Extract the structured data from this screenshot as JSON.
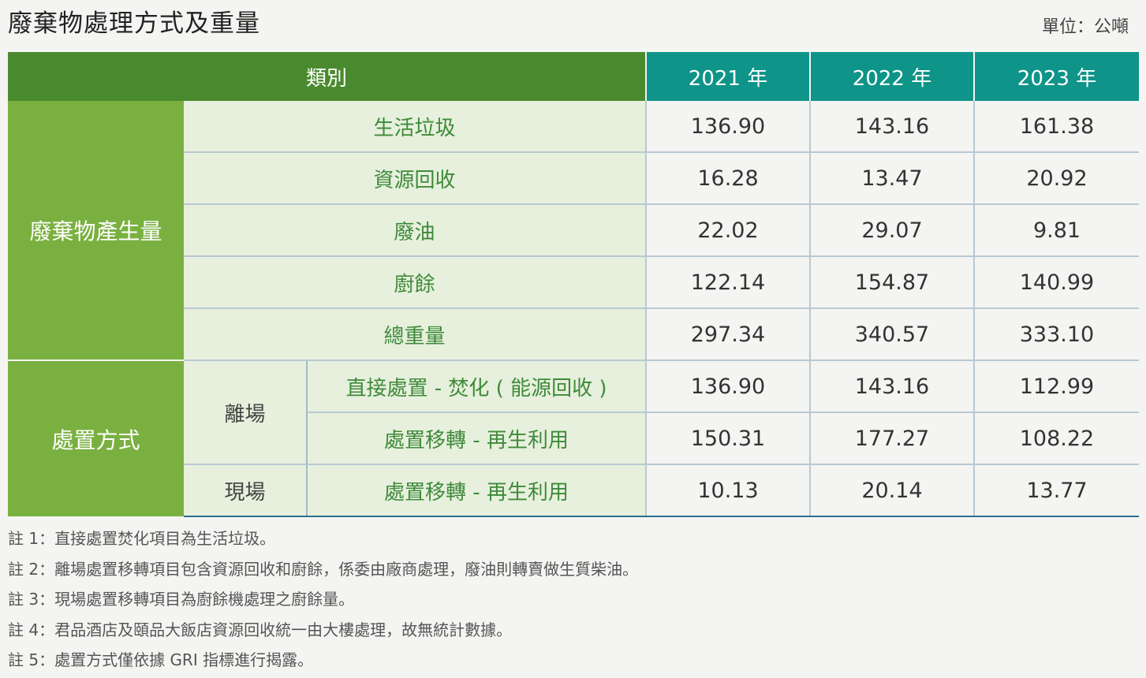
{
  "title": "廢棄物處理方式及重量",
  "unit": "單位：公噸",
  "header": {
    "category": "類別",
    "years": [
      "2021 年",
      "2022 年",
      "2023 年"
    ]
  },
  "groups": {
    "generation": "廢棄物產生量",
    "disposal": "處置方式",
    "offsite": "離場",
    "onsite": "現場"
  },
  "rows": [
    {
      "label": "生活垃圾",
      "values": [
        "136.90",
        "143.16",
        "161.38"
      ]
    },
    {
      "label": "資源回收",
      "values": [
        "16.28",
        "13.47",
        "20.92"
      ]
    },
    {
      "label": "廢油",
      "values": [
        "22.02",
        "29.07",
        "9.81"
      ]
    },
    {
      "label": "廚餘",
      "values": [
        "122.14",
        "154.87",
        "140.99"
      ]
    },
    {
      "label": "總重量",
      "values": [
        "297.34",
        "340.57",
        "333.10"
      ]
    },
    {
      "label": "直接處置 - 焚化 ( 能源回收 )",
      "values": [
        "136.90",
        "143.16",
        "112.99"
      ]
    },
    {
      "label": "處置移轉 - 再生利用",
      "values": [
        "150.31",
        "177.27",
        "108.22"
      ]
    },
    {
      "label": "處置移轉 - 再生利用",
      "values": [
        "10.13",
        "20.14",
        "13.77"
      ]
    }
  ],
  "notes": [
    "註 1：直接處置焚化項目為生活垃圾。",
    "註 2：離場處置移轉項目包含資源回收和廚餘，係委由廠商處理，廢油則轉賣做生質柴油。",
    "註 3：現場處置移轉項目為廚餘機處理之廚餘量。",
    "註 4：君品酒店及頤品大飯店資源回收統一由大樓處理，故無統計數據。",
    "註 5：處置方式僅依據 GRI 指標進行揭露。"
  ]
}
